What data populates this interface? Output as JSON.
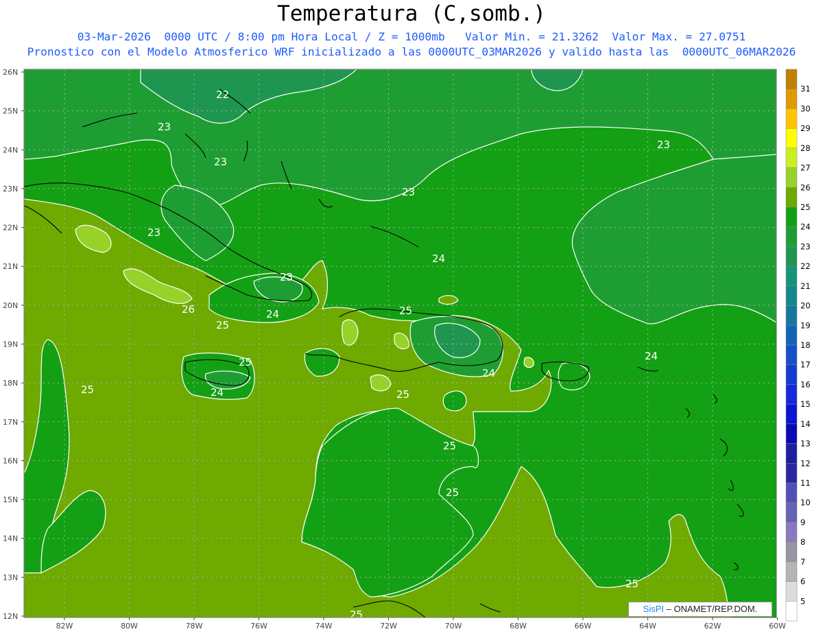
{
  "title": "Temperatura (C,somb.)",
  "subtitle_line1": "03-Mar-2026  0000 UTC / 8:00 pm Hora Local / Z = 1000mb   Valor Min. = 21.3262  Valor Max. = 27.0751",
  "subtitle_line2": "Pronostico con el Modelo Atmosferico WRF inicializado a las 0000UTC_03MAR2026 y valido hasta las  0000UTC_06MAR2026",
  "credit": {
    "brand": "SisPI",
    "text": "– ONAMET/REP.DOM."
  },
  "map": {
    "lat_labels": [
      "26N",
      "25N",
      "24N",
      "23N",
      "22N",
      "21N",
      "20N",
      "19N",
      "18N",
      "17N",
      "16N",
      "15N",
      "14N",
      "13N",
      "12N"
    ],
    "lon_labels": [
      "82W",
      "80W",
      "78W",
      "76W",
      "74W",
      "72W",
      "70W",
      "68W",
      "66W",
      "64W",
      "62W",
      "60W"
    ],
    "contour_labels": [
      "22",
      "23",
      "23",
      "23",
      "23",
      "23",
      "23",
      "24",
      "24",
      "24",
      "24",
      "24",
      "25",
      "25",
      "25",
      "25",
      "25",
      "25",
      "25",
      "25",
      "26"
    ]
  },
  "colorbar": {
    "levels": [
      "31",
      "30",
      "29",
      "28",
      "27",
      "26",
      "25",
      "24",
      "23",
      "22",
      "21",
      "20",
      "19",
      "18",
      "17",
      "16",
      "15",
      "14",
      "13",
      "12",
      "11",
      "10",
      "9",
      "8",
      "7",
      "6",
      "5"
    ],
    "colors": [
      "#c08000",
      "#e09a00",
      "#ffc400",
      "#ffff00",
      "#c8f01e",
      "#96d228",
      "#6eaa00",
      "#14a014",
      "#1e9e32",
      "#1e9650",
      "#14967a",
      "#14878c",
      "#1478a0",
      "#1464b4",
      "#1450c8",
      "#143cd2",
      "#1428dc",
      "#0a14d2",
      "#0a0ab4",
      "#1e1ea0",
      "#2828a0",
      "#5050b4",
      "#6464b4",
      "#8c78be",
      "#9696a0",
      "#b4b4b4",
      "#dcdcdc",
      "#ffffff"
    ]
  }
}
